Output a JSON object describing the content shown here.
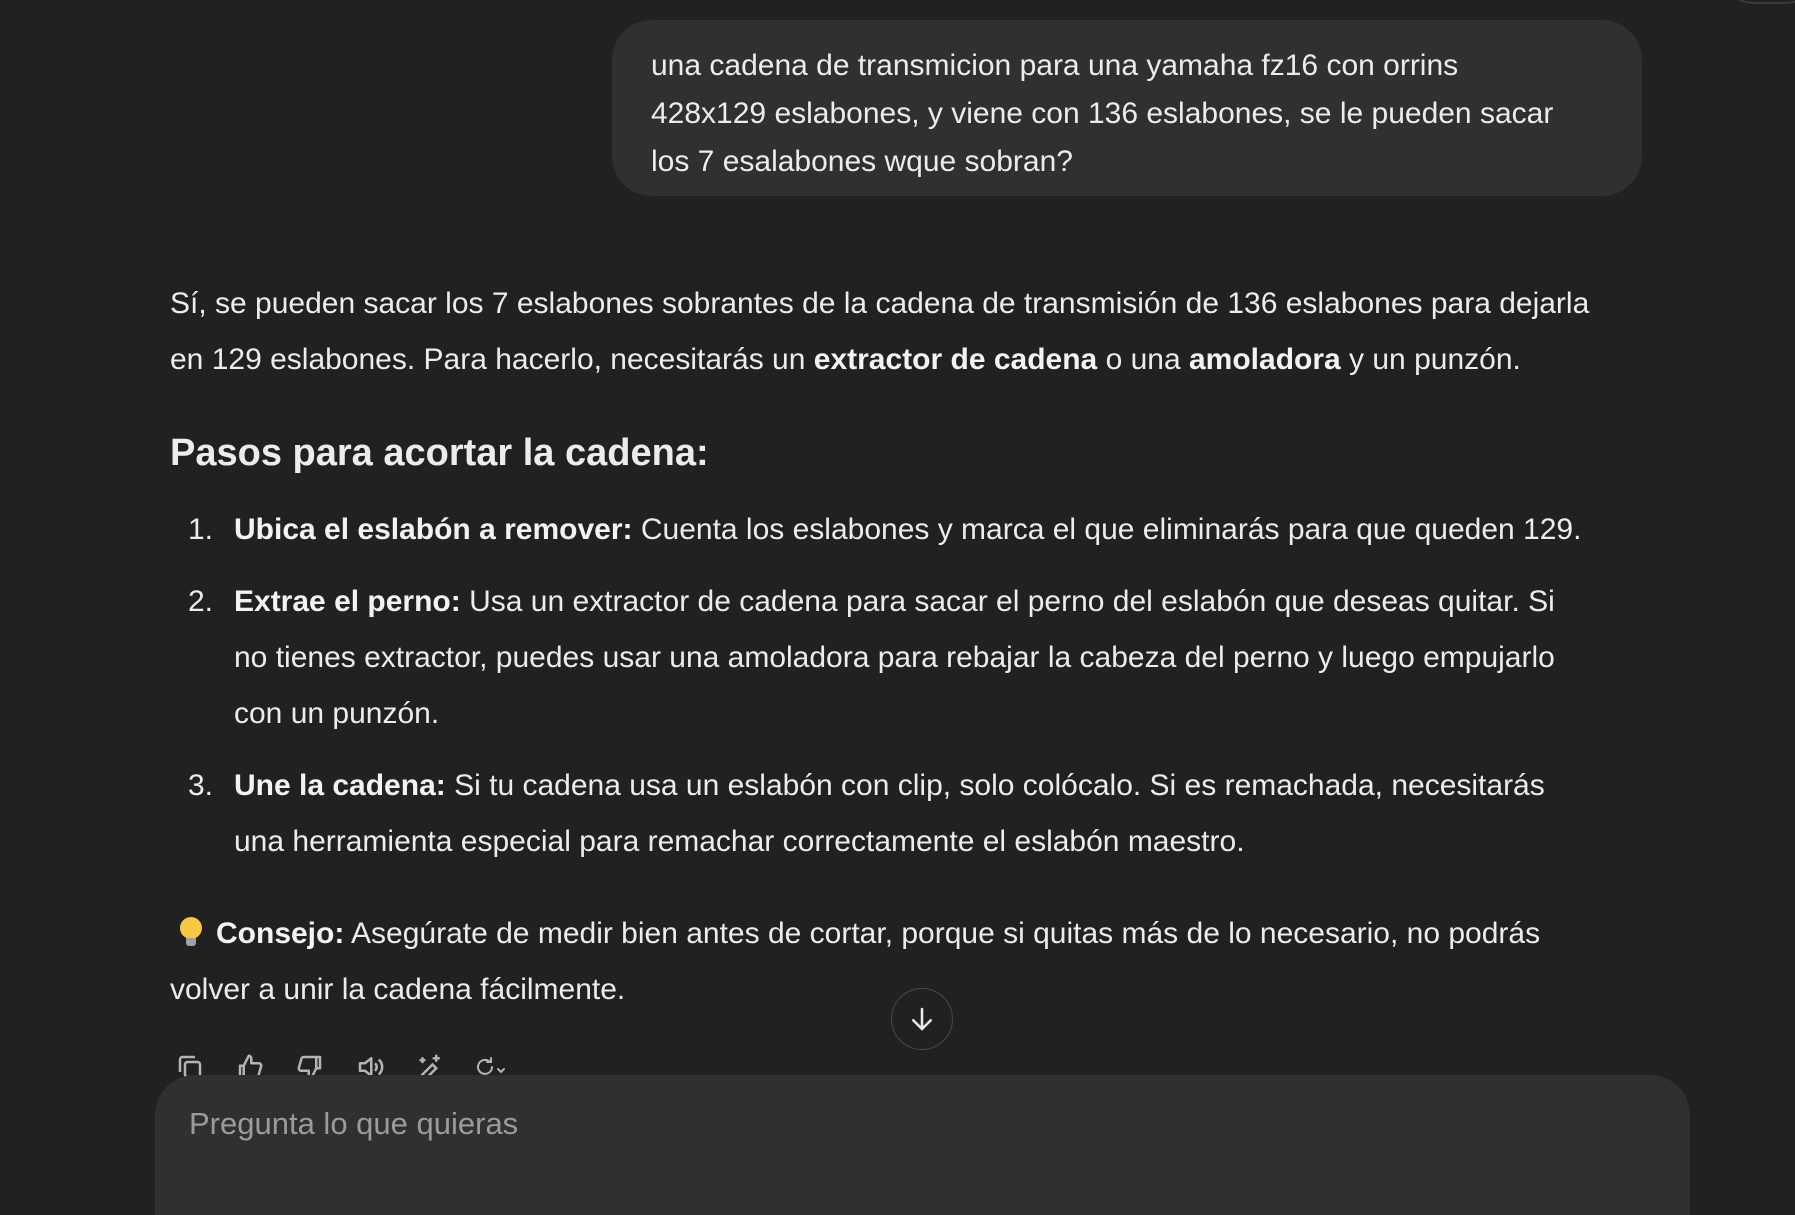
{
  "user_message": {
    "lines": [
      "una cadena de transmicion para una yamaha fz16 con orrins",
      "428x129 eslabones, y viene con 136 eslabones, se le pueden sacar",
      "los 7 esalabones wque sobran?"
    ]
  },
  "assistant": {
    "intro": {
      "line1": "Sí, se pueden sacar los 7 eslabones sobrantes de la cadena de transmisión de 136 eslabones para dejarla",
      "line2_a": "en 129 eslabones. Para hacerlo, necesitarás un ",
      "bold1": "extractor de cadena",
      "line2_b": " o una ",
      "bold2": "amoladora",
      "line2_c": " y un punzón."
    },
    "heading": "Pasos para acortar la cadena:",
    "steps": [
      {
        "number": "1.",
        "title": "Ubica el eslabón a remover:",
        "lines": [
          "Cuenta los eslabones y marca el que eliminarás para que queden 129."
        ]
      },
      {
        "number": "2.",
        "title": "Extrae el perno:",
        "lines": [
          "Usa un extractor de cadena para sacar el perno del eslabón que deseas quitar. Si",
          "no tienes extractor, puedes usar una amoladora para rebajar la cabeza del perno y luego empujarlo",
          "con un punzón."
        ]
      },
      {
        "number": "3.",
        "title": "Une la cadena:",
        "lines": [
          "Si tu cadena usa un eslabón con clip, solo colócalo. Si es remachada, necesitarás",
          "una herramienta especial para remachar correctamente el eslabón maestro."
        ]
      }
    ],
    "tip": {
      "icon": "lightbulb-icon",
      "label": "Consejo:",
      "line1": "Asegúrate de medir bien antes de cortar, porque si quitas más de lo necesario, no podrás",
      "line2": "volver a unir la cadena fácilmente."
    }
  },
  "actions": [
    "copy-icon",
    "thumbs-up-icon",
    "thumbs-down-icon",
    "speaker-icon",
    "edit-sparkle-icon",
    "regenerate-icon"
  ],
  "composer": {
    "placeholder": "Pregunta lo que quieras"
  },
  "colors": {
    "background": "#212121",
    "bubble": "#303030",
    "text": "#ececec",
    "placeholder": "#9b9b9b"
  }
}
